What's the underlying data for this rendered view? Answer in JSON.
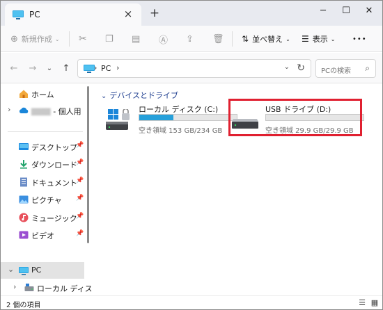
{
  "tab": {
    "title": "PC",
    "close": "×",
    "new_tab": "+"
  },
  "window_controls": {
    "minimize": "─",
    "maximize": "☐",
    "close": "✕"
  },
  "commandbar": {
    "new_label": "新規作成",
    "sort_label": "並べ替え",
    "view_label": "表示",
    "more_label": "•••"
  },
  "address": {
    "path": "PC",
    "sep": "›",
    "search_placeholder": "PCの検索"
  },
  "sidebar": {
    "home": "ホーム",
    "cloud_suffix": "- 個人用",
    "cloud_blurred": "████",
    "quick": [
      {
        "label": "デスクトップ",
        "icon": "desktop-folder-icon"
      },
      {
        "label": "ダウンロード",
        "icon": "download-folder-icon"
      },
      {
        "label": "ドキュメント",
        "icon": "documents-folder-icon"
      },
      {
        "label": "ピクチャ",
        "icon": "pictures-folder-icon"
      },
      {
        "label": "ミュージック",
        "icon": "music-folder-icon"
      },
      {
        "label": "ビデオ",
        "icon": "videos-folder-icon"
      }
    ],
    "pc": "PC",
    "local_disk_trunc": "ローカル ディスク (C"
  },
  "content": {
    "group_header": "デバイスとドライブ",
    "drives": [
      {
        "name": "ローカル ディスク (C:)",
        "info": "空き領域 153 GB/234 GB",
        "used_fraction": 0.35
      },
      {
        "name": "USB ドライブ (D:)",
        "info": "空き領域 29.9 GB/29.9 GB",
        "used_fraction": 0.0
      }
    ]
  },
  "status": {
    "count": "2 個の項目"
  },
  "colors": {
    "accent": "#26a0da",
    "highlight": "#e02030",
    "group_header": "#1d3d8f"
  }
}
